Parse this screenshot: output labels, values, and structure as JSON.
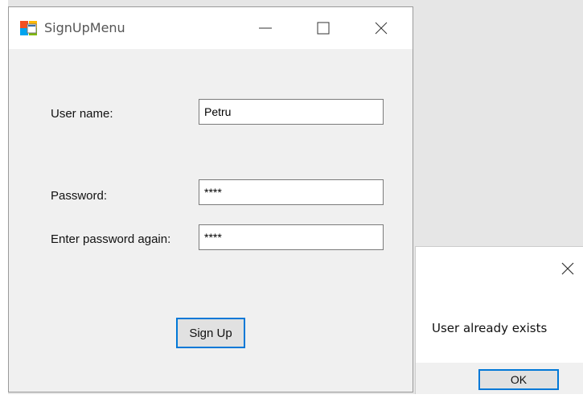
{
  "window": {
    "title": "SignUpMenu",
    "icon": "winforms-app-icon",
    "controls": {
      "minimize": "minimize-icon",
      "maximize": "maximize-icon",
      "close": "close-icon"
    }
  },
  "form": {
    "username_label": "User name:",
    "username_value": "Petru",
    "password_label": "Password:",
    "password_value": "****",
    "password_again_label": "Enter password again:",
    "password_again_value": "****",
    "signup_button": "Sign Up"
  },
  "message_box": {
    "text": "User already exists",
    "ok_button": "OK",
    "close_icon": "close-icon"
  },
  "colors": {
    "accent": "#0078d7",
    "window_bg": "#f0f0f0",
    "desktop_bg": "#e6e6e6"
  }
}
